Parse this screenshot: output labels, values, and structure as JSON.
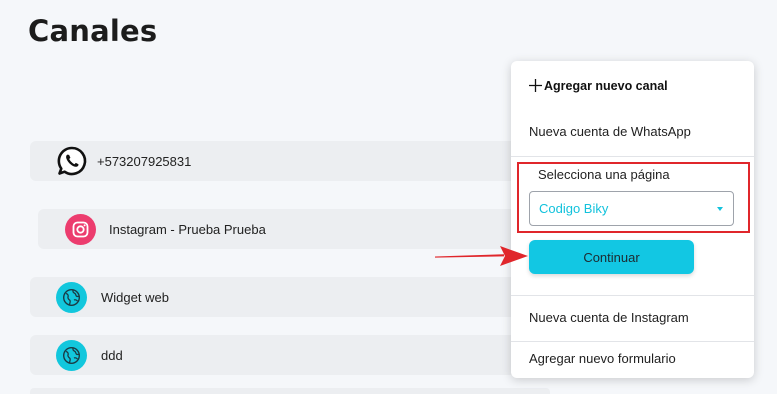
{
  "page": {
    "title": "Canales"
  },
  "channels": [
    {
      "label": "+573207925831",
      "icon": "whatsapp-icon",
      "color": "#000000"
    },
    {
      "label": "Instagram - Prueba Prueba",
      "icon": "instagram-icon",
      "color": "#ec3c6e"
    },
    {
      "label": "Widget web",
      "icon": "globe-icon",
      "color": "#12c7dd"
    },
    {
      "label": "ddd",
      "icon": "globe-icon",
      "color": "#12c7dd"
    }
  ],
  "menu": {
    "header": "Agregar nuevo canal",
    "items": {
      "whatsapp": "Nueva cuenta de WhatsApp",
      "instagram": "Nueva cuenta de Instagram",
      "form": "Agregar nuevo formulario"
    },
    "page_select": {
      "label": "Selecciona una página",
      "value": "Codigo Biky"
    },
    "continue_label": "Continuar"
  },
  "colors": {
    "accent": "#12c7e3",
    "highlight": "#e0262b",
    "instagram": "#ec3c6e"
  }
}
